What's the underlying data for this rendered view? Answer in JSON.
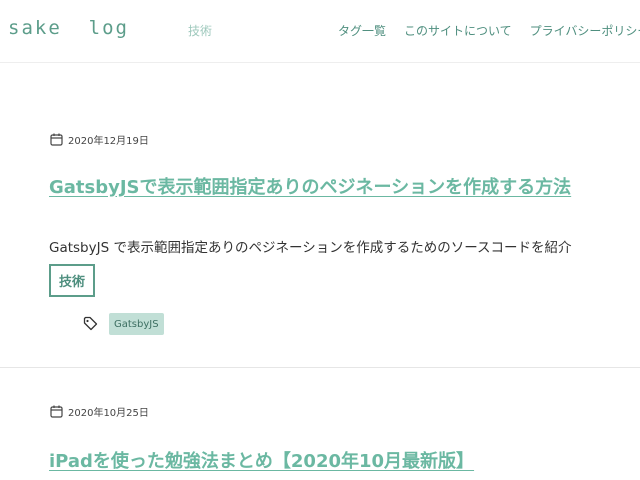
{
  "site": {
    "logo": "sake  log"
  },
  "header": {
    "category_link": "技術",
    "nav": [
      {
        "label": "タグ一覧"
      },
      {
        "label": "このサイトについて"
      },
      {
        "label": "プライバシーポリシー"
      }
    ]
  },
  "posts": [
    {
      "date": "2020年12月19日",
      "title": "GatsbyJSで表示範囲指定ありのペジネーションを作成する方法",
      "excerpt": "GatsbyJS で表示範囲指定ありのペジネーションを作成するためのソースコードを紹介",
      "category": "技術",
      "tags": [
        "GatsbyJS"
      ]
    },
    {
      "date": "2020年10月25日",
      "title": "iPadを使った勉強法まとめ【2020年10月最新版】"
    }
  ],
  "icons": {
    "date": "calendar-icon",
    "tag": "tag-icon"
  },
  "colors": {
    "accent": "#6bb8a2",
    "accent_dark": "#4f8f7f",
    "tag_bg": "#c1dfd6"
  }
}
